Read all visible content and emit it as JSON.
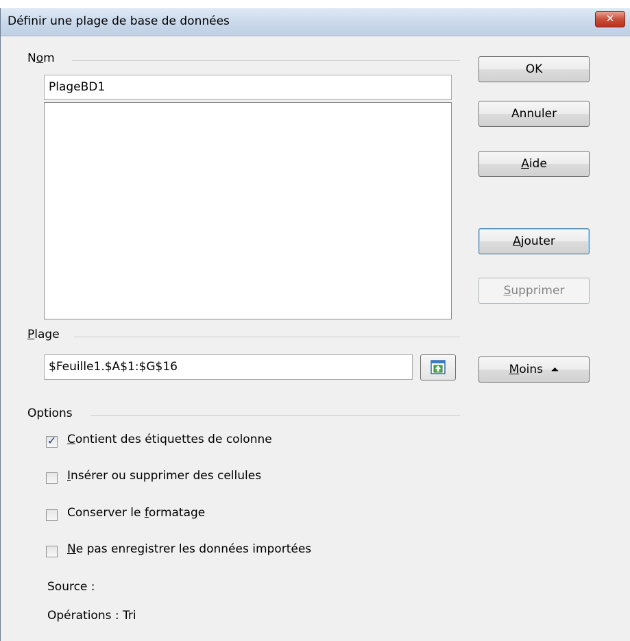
{
  "dialog": {
    "title": "Définir une plage de base de données",
    "close_glyph": "✕"
  },
  "name_section": {
    "label_pre": "N",
    "label_accel": "o",
    "label_post": "m",
    "input_value": "PlageBD1",
    "list_items": []
  },
  "buttons": {
    "ok": "OK",
    "cancel": "Annuler",
    "help_accel": "A",
    "help_rest": "ide",
    "add_accel": "A",
    "add_rest": "jouter",
    "delete_accel": "S",
    "delete_rest": "upprimer",
    "less_accel": "M",
    "less_rest": "oins",
    "less_icon": "⏶"
  },
  "range_section": {
    "label_accel": "P",
    "label_rest": "lage",
    "input_value": "$Feuille1.$A$1:$G$16",
    "shrink_icon": "shrink-icon"
  },
  "options": {
    "label": "Options",
    "items": [
      {
        "pre": "",
        "accel": "C",
        "post": "ontient des étiquettes de colonne",
        "checked": true
      },
      {
        "pre": "",
        "accel": "I",
        "post": "nsérer ou supprimer des cellules",
        "checked": false
      },
      {
        "pre": "Conserver le ",
        "accel": "f",
        "post": "ormatage",
        "checked": false
      },
      {
        "pre": "",
        "accel": "N",
        "post": "e pas enregistrer les données importées",
        "checked": false
      }
    ],
    "check_glyph": "✓"
  },
  "info": {
    "source": "Source :",
    "operations": "Opérations : Tri"
  }
}
